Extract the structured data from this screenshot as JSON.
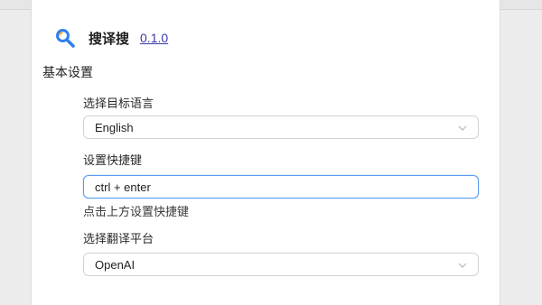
{
  "app": {
    "name": "搜译搜",
    "version": "0.1.0",
    "logo_icon": "magnifier-logo-icon"
  },
  "section": {
    "title": "基本设置"
  },
  "target_language": {
    "label": "选择目标语言",
    "selected": "English"
  },
  "shortcut": {
    "label": "设置快捷键",
    "value": "ctrl + enter",
    "hint": "点击上方设置快捷键"
  },
  "platform": {
    "label": "选择翻译平台",
    "selected": "OpenAI"
  },
  "colors": {
    "link": "#3a39a8",
    "focus_border": "#5a9bf0",
    "logo_primary": "#2f80ed",
    "logo_accent": "#f5a623"
  }
}
